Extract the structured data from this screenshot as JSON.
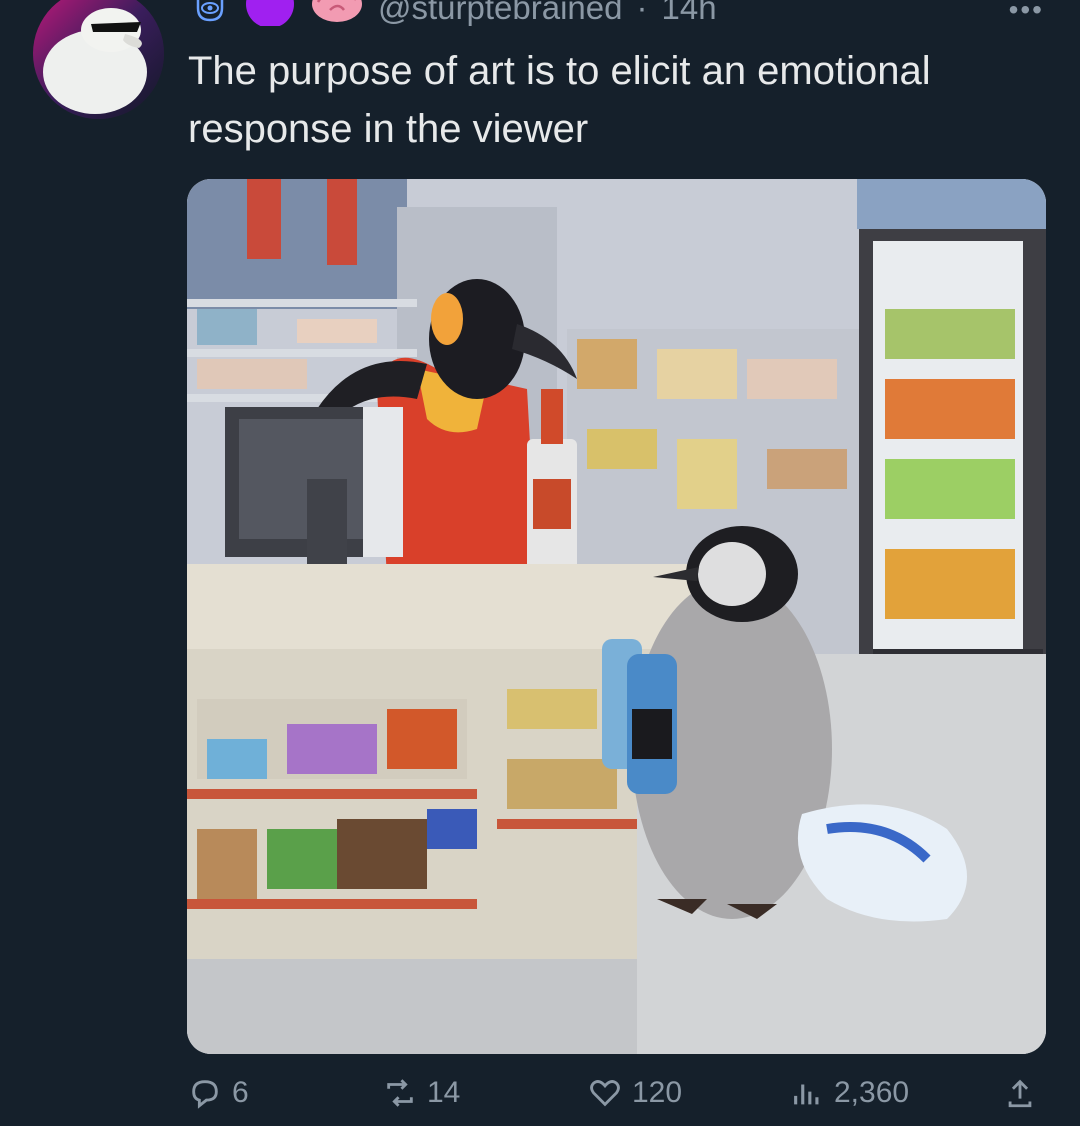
{
  "post": {
    "handle": "@sturptebrained",
    "separator": "·",
    "time": "14h",
    "more_label": "•••",
    "text": "The purpose of art is to elicit an emotional response in the viewer",
    "icons": [
      "hamsa-eye-icon",
      "purple-circle-icon",
      "brain-icon"
    ],
    "media_alt": "Painting of a baby penguin in a convenience store buying soda and a bag of ice while an adult penguin cashier stands behind the counter"
  },
  "stats": {
    "replies": "6",
    "reposts": "14",
    "likes": "120",
    "views": "2,360"
  },
  "colors": {
    "background": "#15202b",
    "text": "#e7e9ea",
    "muted": "#8b98a5",
    "accent_purple": "#a020f0"
  }
}
